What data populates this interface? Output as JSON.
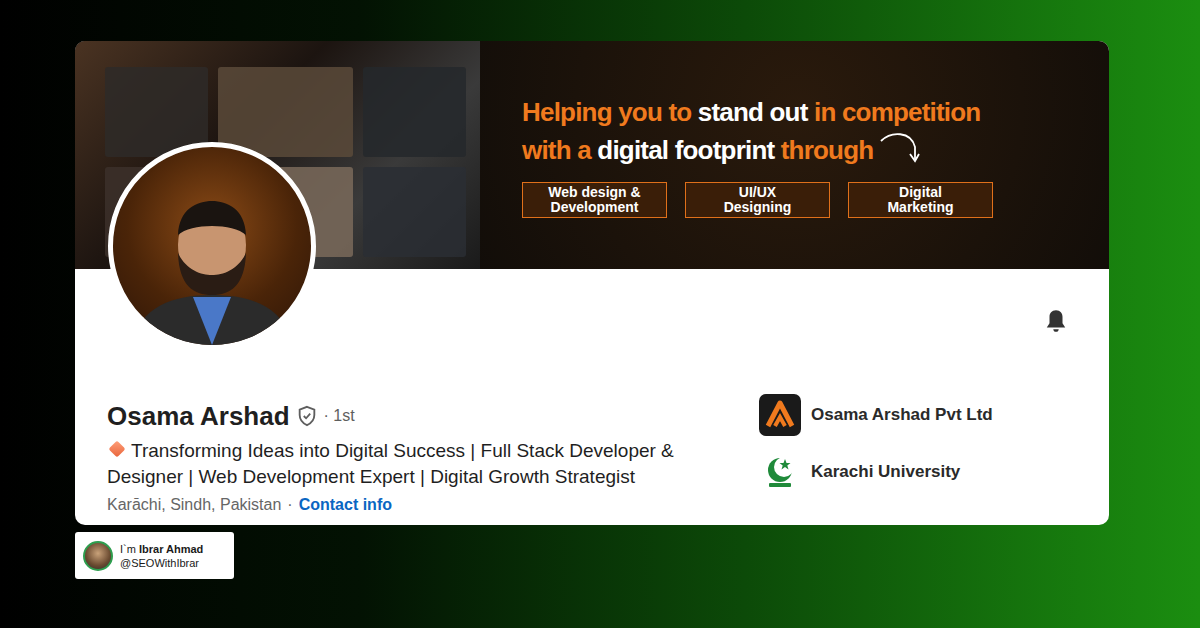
{
  "banner": {
    "tagline": [
      {
        "segments": [
          {
            "text": "Helping you to ",
            "color": "#f07a1e"
          },
          {
            "text": "stand out ",
            "color": "#ffffff"
          },
          {
            "text": "in competition",
            "color": "#f07a1e"
          }
        ]
      },
      {
        "segments": [
          {
            "text": "with a ",
            "color": "#f07a1e"
          },
          {
            "text": "digital footprint ",
            "color": "#ffffff"
          },
          {
            "text": "through",
            "color": "#f07a1e"
          }
        ]
      }
    ],
    "services": [
      {
        "lines": [
          "Web design &",
          "Development"
        ]
      },
      {
        "lines": [
          "UI/UX",
          "Designing"
        ]
      },
      {
        "lines": [
          "Digital",
          "Marketing"
        ]
      }
    ]
  },
  "profile": {
    "name": "Osama Arshad",
    "connection": "· 1st",
    "headline": "Transforming Ideas into Digital Success | Full Stack Developer & Designer | Web Development Expert | Digital Growth Strategist",
    "location": "Karāchi, Sindh, Pakistan",
    "separator": "·",
    "contact_info": "Contact info"
  },
  "organizations": [
    {
      "name": "Osama Arshad Pvt Ltd",
      "kind": "company"
    },
    {
      "name": "Karachi University",
      "kind": "university"
    }
  ],
  "author_badge": {
    "greeting": "I`m",
    "name": "Ibrar Ahmad",
    "handle": "@SEOWithIbrar"
  }
}
